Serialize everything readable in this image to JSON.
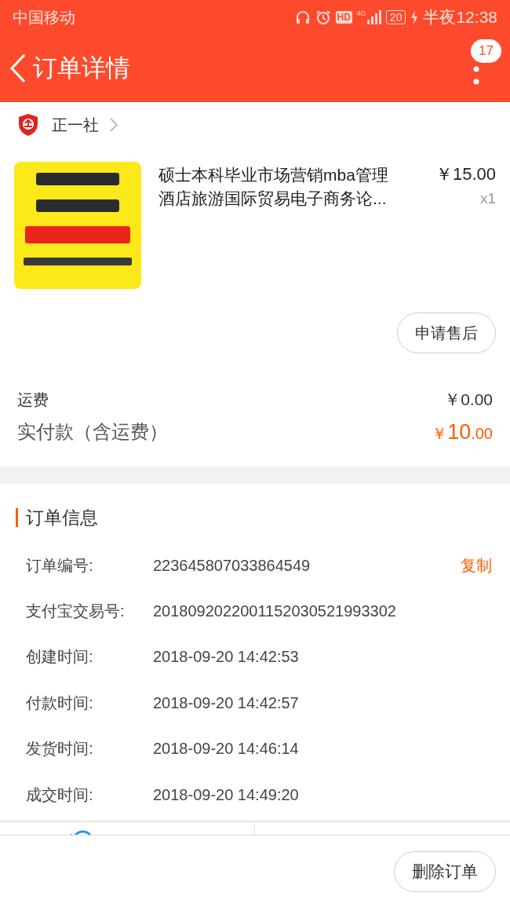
{
  "status_bar": {
    "carrier": "中国移动",
    "hd": "HD",
    "network": "4G",
    "battery": "20",
    "time": "半夜12:38"
  },
  "header": {
    "title": "订单详情",
    "badge": "17"
  },
  "store": {
    "name": "正一社"
  },
  "product": {
    "title": "硕士本科毕业市场营销mba管理酒店旅游国际贸易电子商务论...",
    "price": "￥15.00",
    "quantity": "x1",
    "after_sale_button": "申请售后"
  },
  "fees": [
    {
      "label": "运费",
      "value": "￥0.00",
      "kind": "plain"
    },
    {
      "label": "实付款（含运费）",
      "currency": "￥",
      "value": "10",
      "decimals": ".00",
      "kind": "total"
    }
  ],
  "order_info": {
    "title": "订单信息",
    "rows": [
      {
        "label": "订单编号:",
        "value": "223645807033864549",
        "action": "复制"
      },
      {
        "label": "支付宝交易号:",
        "value": "2018092022001152030521993302"
      },
      {
        "label": "创建时间:",
        "value": "2018-09-20 14:42:53"
      },
      {
        "label": "付款时间:",
        "value": "2018-09-20 14:42:57"
      },
      {
        "label": "发货时间:",
        "value": "2018-09-20 14:46:14"
      },
      {
        "label": "成交时间:",
        "value": "2018-09-20 14:49:20"
      }
    ]
  },
  "bottom_bar": {
    "buttons": [
      "删除订单"
    ]
  }
}
